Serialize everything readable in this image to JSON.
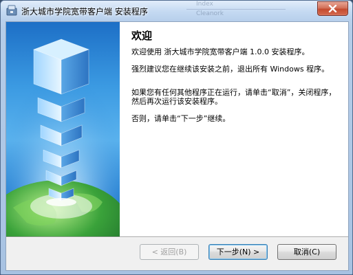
{
  "window": {
    "title": "浙大城市学院宽带客户端 安装程序",
    "background_hint_1": "Index",
    "background_hint_2": "Cleanork"
  },
  "page": {
    "heading": "欢迎",
    "paragraphs": [
      "欢迎使用 浙大城市学院宽带客户端 1.0.0 安装程序。",
      "强烈建议您在继续该安装之前，退出所有 Windows 程序。",
      "如果您有任何其他程序正在运行，请单击“取消”，关闭程序，然后再次运行该安装程序。",
      "否则，请单击“下一步”继续。"
    ]
  },
  "buttons": {
    "back": "< 返回(B)",
    "next": "下一步(N) >",
    "cancel": "取消(C)"
  },
  "icons": {
    "app": "installer-icon",
    "close": "close-icon",
    "banner": "building-globe-illustration"
  },
  "colors": {
    "close_button": "#c44a2f",
    "banner_blue": "#2b84d4",
    "globe_green": "#3aa23a"
  }
}
